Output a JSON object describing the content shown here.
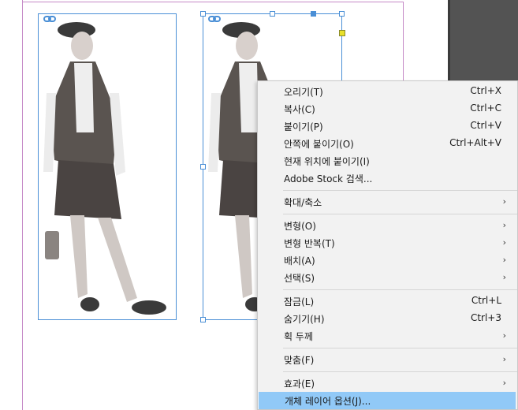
{
  "context_menu": {
    "groups": [
      [
        {
          "label": "오리기(T)",
          "shortcut": "Ctrl+X"
        },
        {
          "label": "복사(C)",
          "shortcut": "Ctrl+C"
        },
        {
          "label": "붙이기(P)",
          "shortcut": "Ctrl+V"
        },
        {
          "label": "안쪽에 붙이기(O)",
          "shortcut": "Ctrl+Alt+V"
        },
        {
          "label": "현재 위치에 붙이기(I)",
          "shortcut": ""
        },
        {
          "label": "Adobe Stock 검색...",
          "shortcut": ""
        }
      ],
      [
        {
          "label": "확대/축소",
          "submenu": true
        }
      ],
      [
        {
          "label": "변형(O)",
          "submenu": true
        },
        {
          "label": "변형 반복(T)",
          "submenu": true
        },
        {
          "label": "배치(A)",
          "submenu": true
        },
        {
          "label": "선택(S)",
          "submenu": true
        }
      ],
      [
        {
          "label": "잠금(L)",
          "shortcut": "Ctrl+L"
        },
        {
          "label": "숨기기(H)",
          "shortcut": "Ctrl+3"
        },
        {
          "label": "획 두께",
          "submenu": true
        }
      ],
      [
        {
          "label": "맞춤(F)",
          "submenu": true
        }
      ],
      [
        {
          "label": "효과(E)",
          "submenu": true
        },
        {
          "label": "개체 레이어 옵션(J)...",
          "highlighted": true
        }
      ]
    ],
    "submenu_arrow": "›"
  },
  "canvas": {
    "images": [
      "fashion-model-photo-1",
      "fashion-model-photo-2"
    ],
    "selection_color": "#4a8fd6",
    "page_border_color": "#c58ac7"
  }
}
